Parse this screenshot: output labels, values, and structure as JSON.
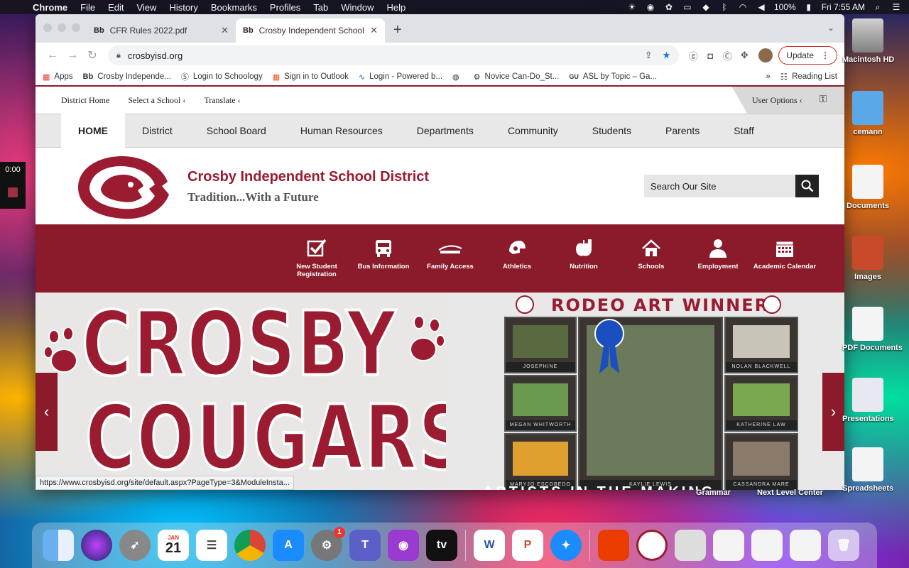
{
  "menubar": {
    "app": "Chrome",
    "items": [
      "File",
      "Edit",
      "View",
      "History",
      "Bookmarks",
      "Profiles",
      "Tab",
      "Window",
      "Help"
    ],
    "battery": "100%",
    "clock": "Fri 7:55 AM"
  },
  "tabs": [
    {
      "favicon": "Bb",
      "title": "CFR Rules 2022.pdf"
    },
    {
      "favicon": "Bb",
      "title": "Crosby Independent School Di"
    }
  ],
  "toolbar": {
    "url": "crosbyisd.org",
    "update_label": "Update"
  },
  "bookmarks": [
    {
      "icon": "apps-grid-icon",
      "label": "Apps"
    },
    {
      "icon": "blackboard-icon",
      "label": "Crosby Independe..."
    },
    {
      "icon": "schoology-icon",
      "label": "Login to Schoology"
    },
    {
      "icon": "microsoft-icon",
      "label": "Sign in to Outlook"
    },
    {
      "icon": "chart-icon",
      "label": "Login - Powered b..."
    },
    {
      "icon": "globe-icon",
      "label": ""
    },
    {
      "icon": "gear-icon",
      "label": "Novice Can-Do_St..."
    },
    {
      "icon": "gu-icon",
      "label": "ASL by Topic – Ga..."
    }
  ],
  "reading_list": "Reading List",
  "site": {
    "utility": {
      "district_home": "District Home",
      "select_school": "Select a School",
      "translate": "Translate",
      "user_options": "User Options"
    },
    "nav": [
      "HOME",
      "District",
      "School Board",
      "Human Resources",
      "Departments",
      "Community",
      "Students",
      "Parents",
      "Staff"
    ],
    "title": "Crosby Independent School District",
    "tagline": "Tradition...With a Future",
    "search_placeholder": "Search Our Site",
    "quicklinks": [
      {
        "label": "New Student Registration",
        "icon": "checkbox-icon"
      },
      {
        "label": "Bus Information",
        "icon": "bus-icon"
      },
      {
        "label": "Family Access",
        "icon": "skyward-icon"
      },
      {
        "label": "Athletics",
        "icon": "helmet-icon"
      },
      {
        "label": "Nutrition",
        "icon": "apple-icon"
      },
      {
        "label": "Schools",
        "icon": "house-icon"
      },
      {
        "label": "Employment",
        "icon": "person-icon"
      },
      {
        "label": "Academic Calendar",
        "icon": "calendar-icon"
      }
    ],
    "hero": {
      "left_line1": "CROSBY",
      "left_line2": "COUGARS",
      "rodeo_title": "RODEO ART WINNERS",
      "artists": [
        "JOSEPHINE MCANESPY",
        "NOLAN BLACKWELL",
        "MEGAN WHITWORTH",
        "KATHERINE LAW",
        "MARYJO ESCOBEDO",
        "KAYLIE LEWIS",
        "CASSANDRA MARE"
      ],
      "caption": "ARTISTS IN THE MAKING"
    },
    "status_url": "https://www.crosbyisd.org/site/default.aspx?PageType=3&ModuleInsta..."
  },
  "recorder": {
    "time": "0:00"
  },
  "desktop": [
    "Macintosh HD",
    "cemann",
    "Documents",
    "Images",
    "PDF Documents",
    "Presentations",
    "Spreadsheets"
  ],
  "desktop_bottom": [
    "Grammar",
    "Next Level Center"
  ],
  "dock": {
    "calendar_month": "JAN",
    "calendar_day": "21",
    "settings_badge": "1",
    "tv_label": "tv"
  }
}
